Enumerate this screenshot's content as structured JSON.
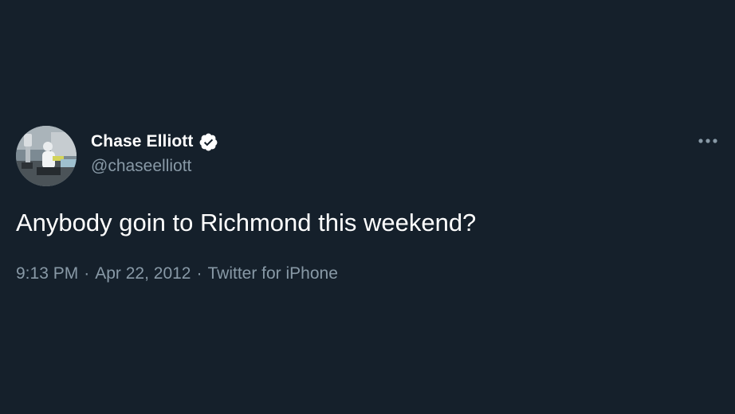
{
  "tweet": {
    "display_name": "Chase Elliott",
    "handle": "@chaseelliott",
    "text": "Anybody goin to Richmond this weekend?",
    "time": "9:13 PM",
    "separator": "·",
    "date": "Apr 22, 2012",
    "source": "Twitter for iPhone",
    "verified_icon": "verified-badge-icon",
    "more_icon": "more-horizontal-icon"
  },
  "colors": {
    "background": "#15202b",
    "primary_text": "#ffffff",
    "secondary_text": "#8899a6"
  }
}
